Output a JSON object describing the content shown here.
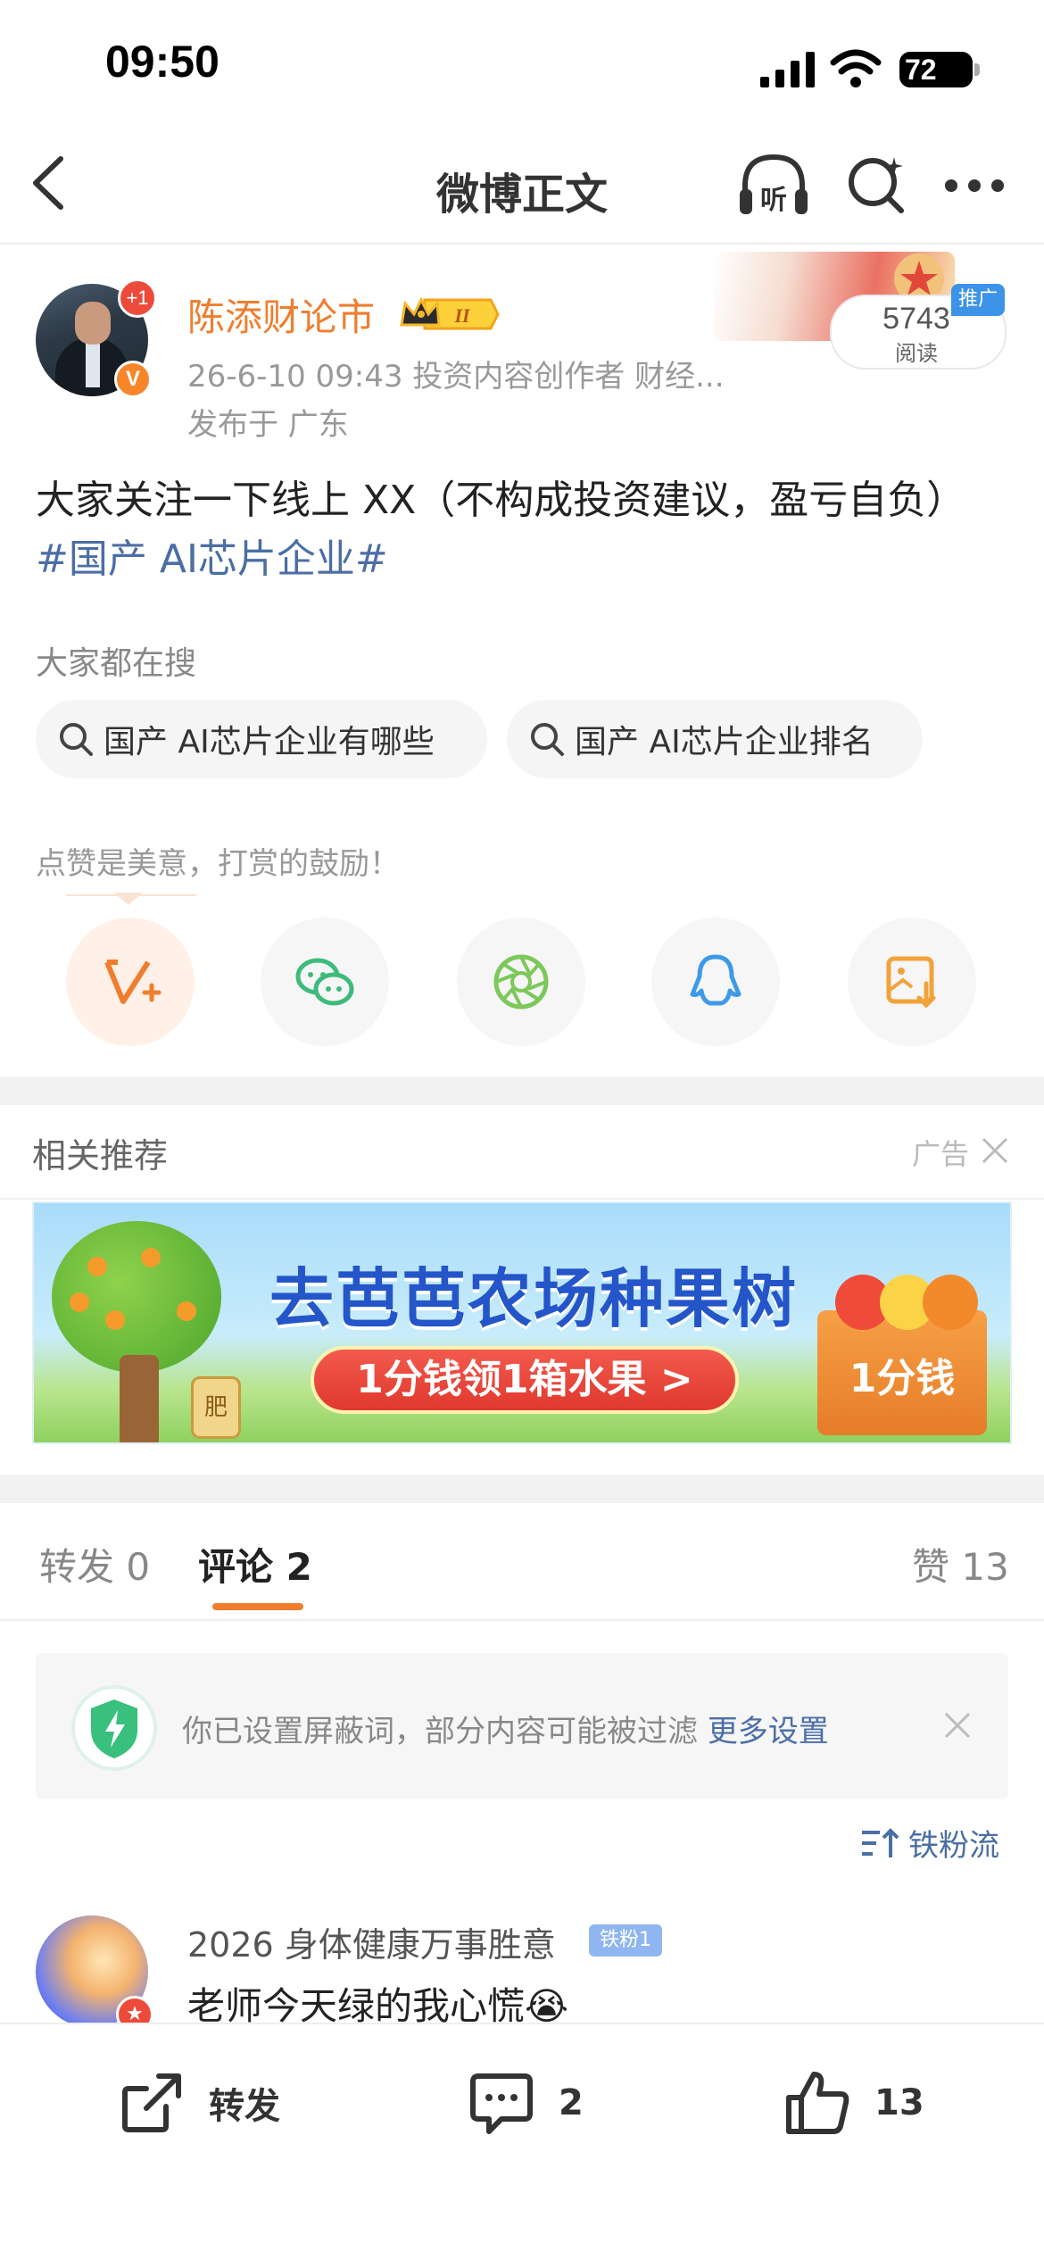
{
  "status_bar": {
    "time": "09:50",
    "battery": "72"
  },
  "nav": {
    "title": "微博正文",
    "listen_label": "听"
  },
  "post": {
    "author": "陈添财论市",
    "level_badge": "II",
    "unread_badge": "+1",
    "verified_badge": "V",
    "meta": "26-6-10 09:43  投资内容创作者 财经...",
    "location": "发布于 广东",
    "reads_count": "5743",
    "reads_label": "阅读",
    "promo_tag": "推广",
    "text": "大家关注一下线上 XX（不构成投资建议，盈亏自负）",
    "hashtag": "#国产 AI芯片企业#",
    "search_label": "大家都在搜",
    "search_chips": [
      "国产 AI芯片企业有哪些",
      "国产 AI芯片企业排名"
    ],
    "tip_text": "点赞是美意，打赏的鼓励！"
  },
  "share_targets": [
    {
      "name": "reward",
      "icon": "reward-v-icon"
    },
    {
      "name": "wechat",
      "icon": "wechat-icon"
    },
    {
      "name": "moments",
      "icon": "moments-aperture-icon"
    },
    {
      "name": "qq",
      "icon": "qq-penguin-icon"
    },
    {
      "name": "save-image",
      "icon": "save-image-icon"
    }
  ],
  "ad": {
    "section_title": "相关推荐",
    "ad_label": "广告",
    "headline": "去芭芭农场种果树",
    "cta": "1分钱领1箱水果 >",
    "box_text": "1分钱",
    "sign_text": "肥"
  },
  "tabs": {
    "repost": "转发 0",
    "comment": "评论 2",
    "like": "赞 13"
  },
  "notice": {
    "text": "你已设置屏蔽词，部分内容可能被过滤",
    "link": "更多设置"
  },
  "sort_label": "铁粉流",
  "comments": [
    {
      "user": "2026 身体健康万事胜意",
      "fan_badge": "铁粉1",
      "text": "老师今天绿的我心慌😭"
    }
  ],
  "bottom_bar": {
    "repost_label": "转发",
    "comment_count": "2",
    "like_count": "13"
  },
  "colors": {
    "accent": "#f07d2e",
    "link": "#4b6ea5",
    "muted": "#999999"
  }
}
